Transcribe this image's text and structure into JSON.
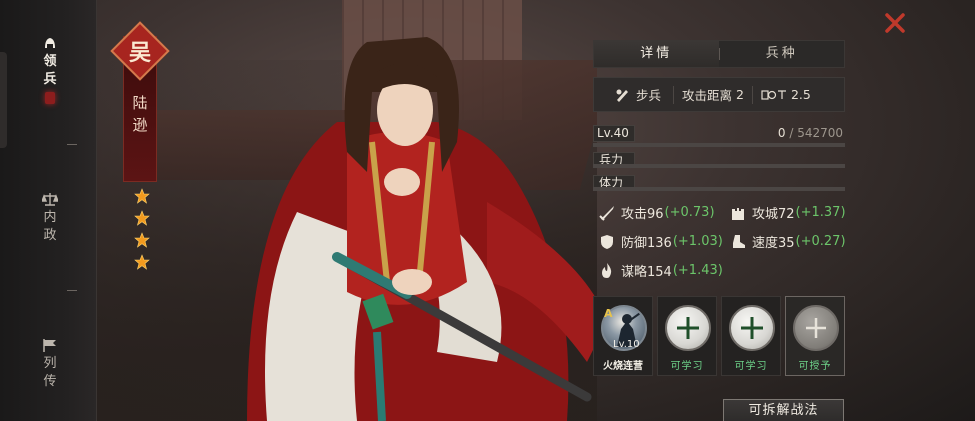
{
  "sidebar": {
    "items": [
      {
        "label_1": "领",
        "label_2": "兵",
        "icon": "helmet-icon",
        "active": true
      },
      {
        "label_1": "内",
        "label_2": "政",
        "icon": "scales-icon",
        "active": false
      },
      {
        "label_1": "列",
        "label_2": "传",
        "icon": "flag-icon",
        "active": false
      }
    ]
  },
  "hero": {
    "faction": "吴",
    "name_1": "陆",
    "name_2": "逊",
    "stars": 4
  },
  "tabs": [
    {
      "label": "详情",
      "active": true
    },
    {
      "label": "兵种",
      "active": false
    }
  ],
  "info": {
    "troop_type": "步兵",
    "range_label": "攻击距离",
    "range_value": "2",
    "cost_value": "2.5",
    "cost_icon": "cost-icon"
  },
  "level": {
    "label": "Lv.40",
    "exp_current": "0",
    "exp_total": "542700",
    "exp_progress": 0
  },
  "bars": {
    "troops_label": "兵力",
    "stamina_label": "体力"
  },
  "attributes": {
    "attack": {
      "label": "攻击96",
      "bonus": "(+0.73)",
      "icon": "sword-icon"
    },
    "siege": {
      "label": "攻城72",
      "bonus": "(+1.37)",
      "icon": "castle-icon"
    },
    "defense": {
      "label": "防御136",
      "bonus": "(+1.03)",
      "icon": "shield-icon"
    },
    "speed": {
      "label": "速度35",
      "bonus": "(+0.27)",
      "icon": "boot-icon"
    },
    "strategy": {
      "label": "谋略154",
      "bonus": "(+1.43)",
      "icon": "flame-icon"
    }
  },
  "skills": [
    {
      "label": "火烧连营",
      "grade": "A",
      "level": "Lv.10",
      "type": "owned"
    },
    {
      "label": "可学习",
      "type": "learnable"
    },
    {
      "label": "可学习",
      "type": "learnable"
    },
    {
      "label": "可授予",
      "type": "grantable"
    }
  ],
  "action_button": "可拆解战法",
  "colors": {
    "accent_red": "#a7251f",
    "bonus_green": "#6cc56a",
    "skill_green": "#6ed38a",
    "close_red": "#c0392b"
  }
}
